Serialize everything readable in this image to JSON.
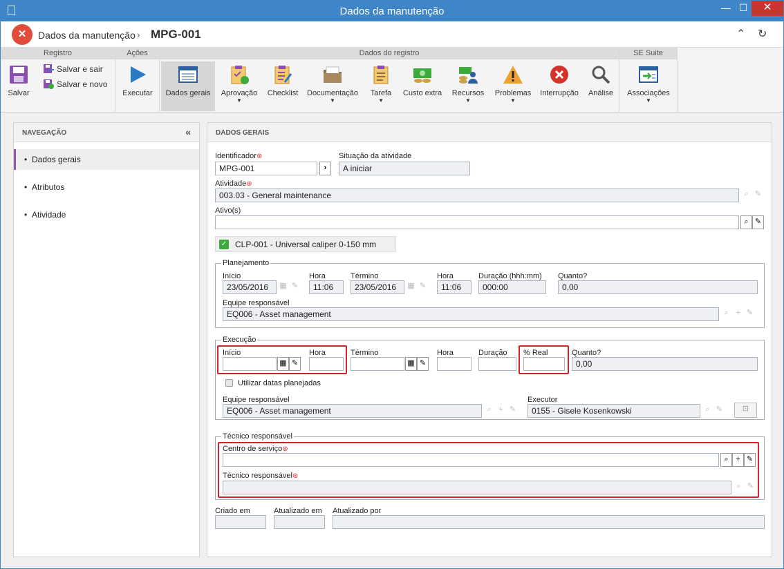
{
  "window": {
    "title": "Dados da manutenção",
    "min": "—",
    "max": "☐",
    "close": "✕"
  },
  "header": {
    "breadcrumb": "Dados da manutenção",
    "sep": "›",
    "record": "MPG-001",
    "logo": "✕",
    "collapse": "⌃",
    "refresh": "↻"
  },
  "ribbon": {
    "groups": {
      "registro": "Registro",
      "acoes": "Ações",
      "dados": "Dados do registro",
      "suite": "SE Suite"
    },
    "save": "Salvar",
    "save_exit": "Salvar e sair",
    "save_new": "Salvar e novo",
    "execute": "Executar",
    "items": [
      "Dados gerais",
      "Aprovação",
      "Checklist",
      "Documentação",
      "Tarefa",
      "Custo extra",
      "Recursos",
      "Problemas",
      "Interrupção",
      "Análise",
      "Associações"
    ],
    "dd": "▼"
  },
  "nav": {
    "title": "NAVEGAÇÃO",
    "collapse": "«",
    "bullet": "•",
    "items": [
      "Dados gerais",
      "Atributos",
      "Atividade"
    ]
  },
  "main": {
    "title": "DADOS GERAIS"
  },
  "form": {
    "identificador_label": "Identificador",
    "identificador": "MPG-001",
    "situacao_label": "Situação da atividade",
    "situacao": "A iniciar",
    "atividade_label": "Atividade",
    "atividade": "003.03 - General maintenance",
    "ativos_label": "Ativo(s)",
    "ativo_chip": "CLP-001 - Universal caliper 0-150 mm",
    "req": "⊛",
    "go": "›",
    "plan": {
      "legend": "Planejamento",
      "inicio_label": "Início",
      "inicio": "23/05/2016",
      "hora_label": "Hora",
      "hora": "11:06",
      "termino_label": "Término",
      "termino": "23/05/2016",
      "hora2": "11:06",
      "duracao_label": "Duração (hhh:mm)",
      "duracao": "000:00",
      "quanto_label": "Quanto?",
      "quanto": "0,00",
      "equipe_label": "Equipe responsável",
      "equipe": "EQ006 - Asset management"
    },
    "exec": {
      "legend": "Execução",
      "inicio_label": "Início",
      "hora_label": "Hora",
      "termino_label": "Término",
      "hora2_label": "Hora",
      "duracao_label": "Duração",
      "real_label": "% Real",
      "quanto_label": "Quanto?",
      "quanto": "0,00",
      "usar_label": "Utilizar datas planejadas",
      "equipe_label": "Equipe responsável",
      "equipe": "EQ006 - Asset management",
      "executor_label": "Executor",
      "executor": "0155 - Gisele Kosenkowski"
    },
    "tec": {
      "legend": "Técnico responsável",
      "centro_label": "Centro de serviço",
      "tecnico_label": "Técnico responsável"
    },
    "criado_label": "Criado em",
    "atualizado_label": "Atualizado em",
    "atualizado_por_label": "Atualizado por"
  },
  "icons": {
    "search": "⌕",
    "clear": "✎",
    "add": "+",
    "cal": "▦",
    "lock": "⊡"
  }
}
